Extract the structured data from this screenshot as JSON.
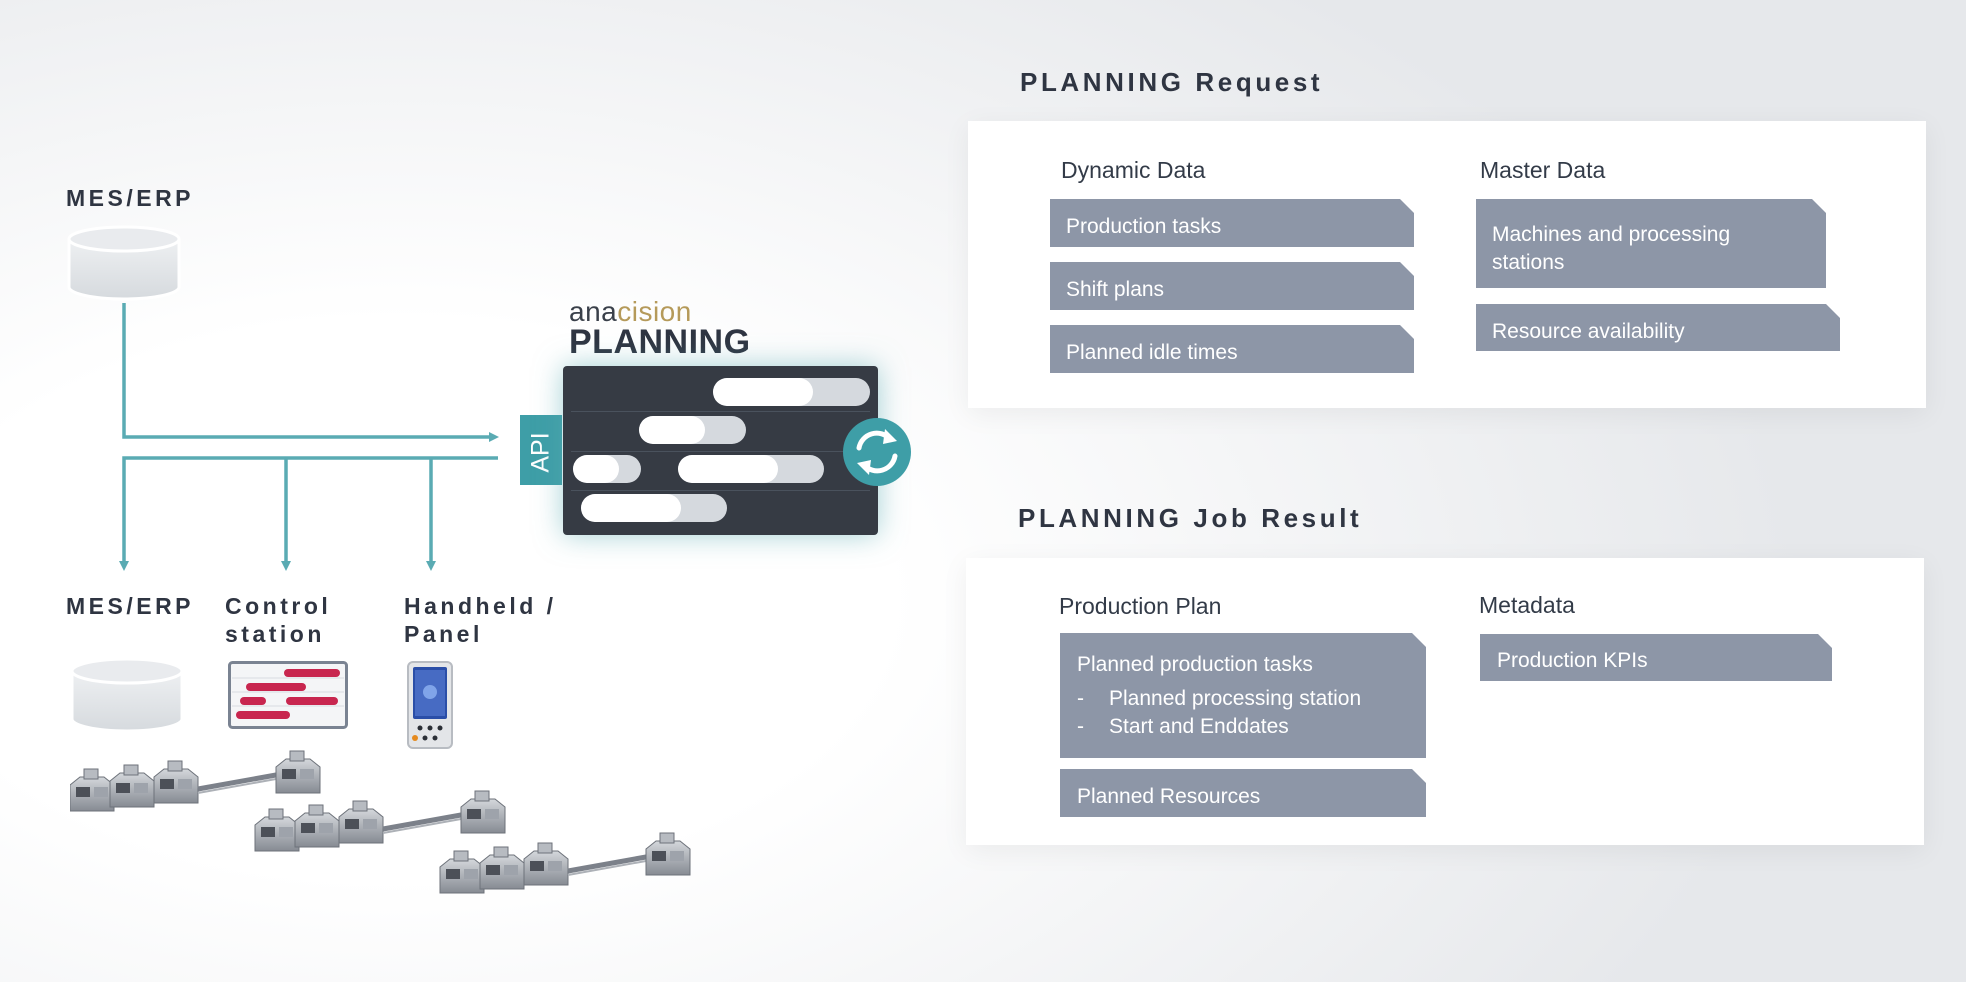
{
  "left": {
    "source_label": "MES/ERP",
    "brand_prefix": "ana",
    "brand_suffix": "cision",
    "product": "PLANNING",
    "api_label": "API",
    "targets": [
      {
        "label": "MES/ERP"
      },
      {
        "label": "Control station"
      },
      {
        "label": "Handheld / Panel"
      }
    ]
  },
  "request": {
    "title": "PLANNING Request",
    "dynamic": {
      "heading": "Dynamic Data",
      "items": [
        "Production tasks",
        "Shift plans",
        "Planned idle times"
      ]
    },
    "master": {
      "heading": "Master Data",
      "items": [
        "Machines and processing stations",
        "Resource availability"
      ]
    }
  },
  "result": {
    "title": "PLANNING Job Result",
    "plan": {
      "heading": "Production Plan",
      "main": "Planned production tasks",
      "bullets": [
        "Planned processing station",
        "Start and Enddates"
      ],
      "resources": "Planned Resources"
    },
    "meta": {
      "heading": "Metadata",
      "items": [
        "Production KPIs"
      ]
    }
  },
  "colors": {
    "teal": "#5aabb3",
    "card": "#8d96a7",
    "dark": "#2f3542",
    "brand_gold": "#b59a5a",
    "gantt_red": "#c8264f"
  },
  "icons": [
    "database-icon",
    "gantt-screen-icon",
    "handheld-device-icon",
    "sync-icon",
    "production-machine-icon"
  ]
}
